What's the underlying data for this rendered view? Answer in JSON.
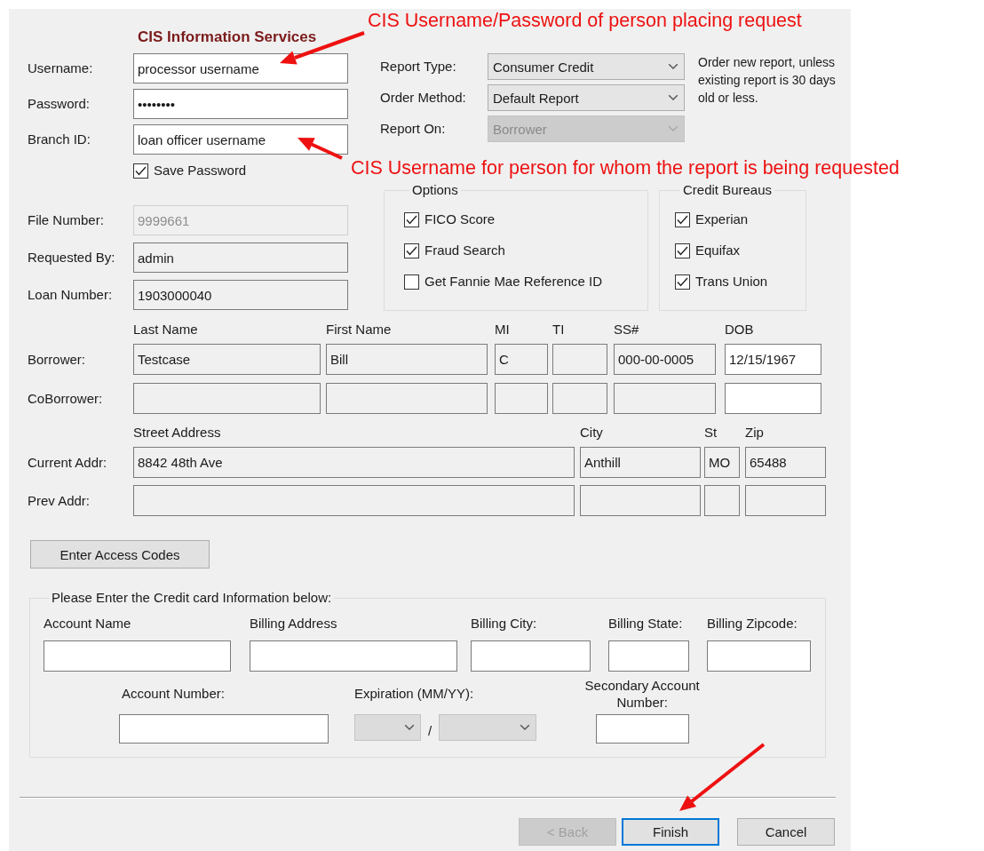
{
  "annotations": [
    "CIS Username/Password of person placing request",
    "CIS Username for person for whom the report is being requested"
  ],
  "title": "CIS Information Services",
  "login_fields": [
    {
      "label": "Username:",
      "value": "processor username"
    },
    {
      "label": "Password:",
      "value": "••••••••"
    },
    {
      "label": "Branch ID:",
      "value": "loan officer username"
    }
  ],
  "save_password": {
    "label": "Save Password",
    "checked": true
  },
  "report_settings": [
    {
      "label": "Report Type:",
      "value": "Consumer Credit",
      "disabled": false
    },
    {
      "label": "Order Method:",
      "value": "Default Report",
      "disabled": false
    },
    {
      "label": "Report On:",
      "value": "Borrower",
      "disabled": true
    }
  ],
  "report_note": "Order new report, unless existing report is 30 days old or less.",
  "file_fields": [
    {
      "label": "File Number:",
      "value": "9999661",
      "disabled": true,
      "readonly": true
    },
    {
      "label": "Requested By:",
      "value": "admin",
      "disabled": false,
      "readonly": true
    },
    {
      "label": "Loan Number:",
      "value": "1903000040",
      "disabled": false,
      "readonly": true
    }
  ],
  "option_groups": [
    {
      "title": "Options",
      "items": [
        {
          "label": "FICO Score",
          "checked": true
        },
        {
          "label": "Fraud Search",
          "checked": true
        },
        {
          "label": "Get Fannie Mae Reference ID",
          "checked": false
        }
      ]
    },
    {
      "title": "Credit Bureaus",
      "items": [
        {
          "label": "Experian",
          "checked": true
        },
        {
          "label": "Equifax",
          "checked": true
        },
        {
          "label": "Trans Union",
          "checked": true
        }
      ]
    }
  ],
  "names": {
    "columns": [
      "Last Name",
      "First Name",
      "MI",
      "TI",
      "SS#",
      "DOB"
    ],
    "rows": [
      {
        "label": "Borrower:",
        "cells": [
          {
            "value": "Testcase",
            "readonly": true
          },
          {
            "value": "Bill",
            "readonly": true
          },
          {
            "value": "C",
            "readonly": true
          },
          {
            "readonly": true
          },
          {
            "value": "000-00-0005",
            "readonly": true
          },
          {
            "value": "12/15/1967",
            "readonly": false
          }
        ]
      },
      {
        "label": "CoBorrower:",
        "cells": [
          {
            "readonly": true
          },
          {
            "readonly": true
          },
          {
            "readonly": true
          },
          {
            "readonly": true
          },
          {
            "readonly": true
          },
          {
            "readonly": false
          }
        ]
      }
    ]
  },
  "addresses": {
    "columns": [
      "Street Address",
      "City",
      "St",
      "Zip"
    ],
    "rows": [
      {
        "label": "Current Addr:",
        "cells": [
          {
            "value": "8842 48th Ave",
            "readonly": true
          },
          {
            "value": "Anthill",
            "readonly": true
          },
          {
            "value": "MO",
            "readonly": true
          },
          {
            "value": "65488",
            "readonly": true
          }
        ]
      },
      {
        "label": "Prev Addr:",
        "cells": [
          {
            "readonly": true
          },
          {
            "readonly": true
          },
          {
            "readonly": true
          },
          {
            "readonly": true
          }
        ]
      }
    ]
  },
  "access_codes_button": "Enter Access Codes",
  "credit_card": {
    "title": "Please Enter the Credit card Information below:",
    "fields": [
      {
        "label": "Account Name"
      },
      {
        "label": "Billing Address"
      },
      {
        "label": "Billing City:"
      },
      {
        "label": "Billing State:"
      },
      {
        "label": "Billing Zipcode:"
      }
    ],
    "account_number": {
      "label": "Account Number:"
    },
    "expiration": {
      "label": "Expiration (MM/YY):",
      "separator": "/",
      "disabled": true
    },
    "secondary_account": {
      "label": "Secondary Account Number:"
    }
  },
  "buttons": [
    {
      "label": "< Back",
      "disabled": true,
      "focused": false
    },
    {
      "label": "Finish",
      "disabled": false,
      "focused": true
    },
    {
      "label": "Cancel",
      "disabled": false,
      "focused": false
    }
  ]
}
